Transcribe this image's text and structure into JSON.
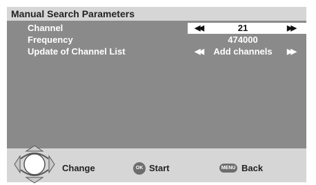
{
  "header": {
    "title": "Manual Search Parameters"
  },
  "params": [
    {
      "label": "Channel",
      "value": "21",
      "left_arrow": "◀◀",
      "right_arrow": "▶▶",
      "selected": true
    },
    {
      "label": "Frequency",
      "value": "474000",
      "left_arrow": "",
      "right_arrow": "",
      "selected": false
    },
    {
      "label": "Update of Channel List",
      "value": "Add channels",
      "left_arrow": "◀◀",
      "right_arrow": "▶▶",
      "selected": false
    }
  ],
  "footer": {
    "change_label": "Change",
    "start_label": "Start",
    "back_label": "Back",
    "ok_icon_text": "OK",
    "menu_icon_text": "MENU"
  },
  "colors": {
    "background": "#d6d6d6",
    "panel": "#8a8a8a",
    "selected_row": "#ffffff",
    "icon": "#6d6d6d"
  }
}
